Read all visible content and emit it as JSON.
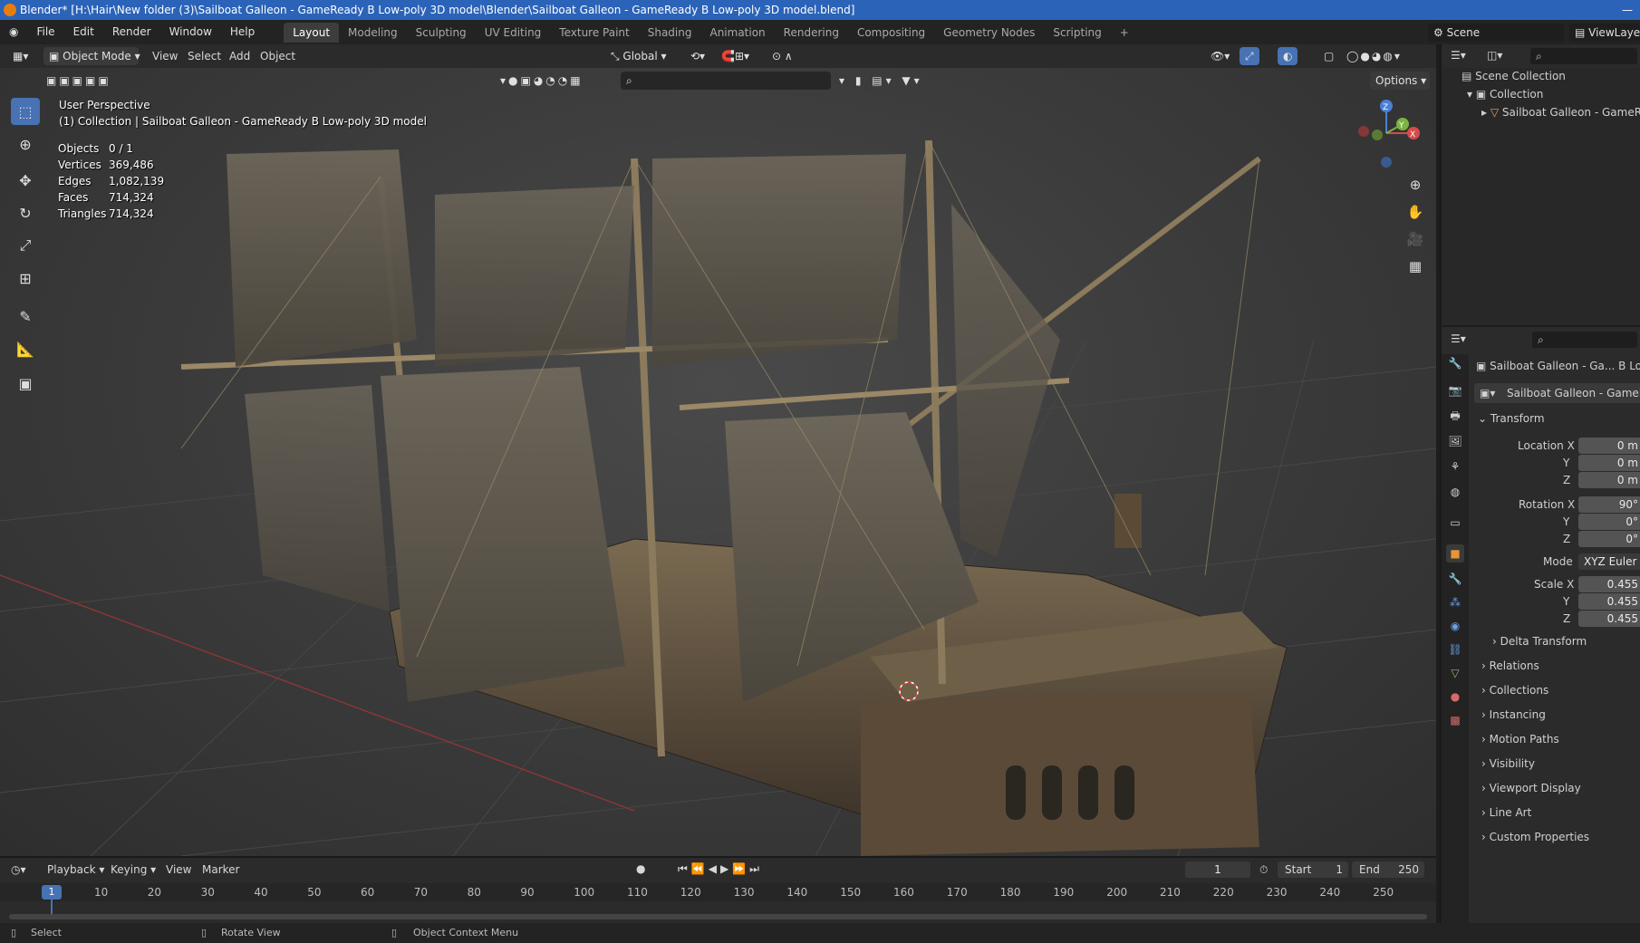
{
  "window": {
    "title": "Blender* [H:\\Hair\\New folder (3)\\Sailboat Galleon - GameReady B Low-poly 3D model\\Blender\\Sailboat Galleon - GameReady B Low-poly 3D model.blend]"
  },
  "menu": {
    "items": [
      "File",
      "Edit",
      "Render",
      "Window",
      "Help"
    ],
    "workspaces": [
      "Layout",
      "Modeling",
      "Sculpting",
      "UV Editing",
      "Texture Paint",
      "Shading",
      "Animation",
      "Rendering",
      "Compositing",
      "Geometry Nodes",
      "Scripting"
    ],
    "active_workspace": "Layout",
    "add_tab": "+",
    "scene_label": "Scene",
    "viewlayer_label": "ViewLayer"
  },
  "viewport_header": {
    "mode": "Object Mode",
    "menus": [
      "View",
      "Select",
      "Add",
      "Object"
    ],
    "transform_orientation": "Global",
    "options_label": "Options"
  },
  "viewport": {
    "perspective": "User Perspective",
    "collection_line": "(1) Collection | Sailboat Galleon - GameReady B Low-poly 3D model",
    "stats": [
      {
        "label": "Objects",
        "value": "0 / 1"
      },
      {
        "label": "Vertices",
        "value": "369,486"
      },
      {
        "label": "Edges",
        "value": "1,082,139"
      },
      {
        "label": "Faces",
        "value": "714,324"
      },
      {
        "label": "Triangles",
        "value": "714,324"
      }
    ],
    "gizmo_axes": {
      "x": "X",
      "y": "Y",
      "z": "Z"
    }
  },
  "outliner": {
    "items": [
      {
        "label": "Scene Collection"
      },
      {
        "label": "Collection"
      },
      {
        "label": "Sailboat Galleon - GameReady"
      }
    ]
  },
  "properties": {
    "object_name": "Sailboat Galleon - Ga... B Low-p",
    "data_name": "Sailboat Galleon - GameReady",
    "transform_header": "Transform",
    "location": {
      "label_x": "Location X",
      "x": "0 m",
      "y": "0 m",
      "z": "0 m"
    },
    "rotation": {
      "label_x": "Rotation X",
      "x": "90°",
      "y": "0°",
      "z": "0°"
    },
    "mode": {
      "label": "Mode",
      "value": "XYZ Euler"
    },
    "scale": {
      "label_x": "Scale X",
      "x": "0.455",
      "y": "0.455",
      "z": "0.455"
    },
    "axis_labels": {
      "y": "Y",
      "z": "Z"
    },
    "sections": [
      "Delta Transform",
      "Relations",
      "Collections",
      "Instancing",
      "Motion Paths",
      "Visibility",
      "Viewport Display",
      "Line Art",
      "Custom Properties"
    ]
  },
  "timeline": {
    "menus": [
      "Playback",
      "Keying",
      "View",
      "Marker"
    ],
    "current_frame": "1",
    "start_label": "Start",
    "start": "1",
    "end_label": "End",
    "end": "250",
    "ruler": [
      "10",
      "20",
      "30",
      "40",
      "50",
      "60",
      "70",
      "80",
      "90",
      "100",
      "110",
      "120",
      "130",
      "140",
      "150",
      "160",
      "170",
      "180",
      "190",
      "200",
      "210",
      "220",
      "230",
      "240",
      "250"
    ],
    "playhead": "1"
  },
  "statusbar": {
    "items": [
      "Select",
      "Rotate View",
      "Object Context Menu"
    ]
  }
}
